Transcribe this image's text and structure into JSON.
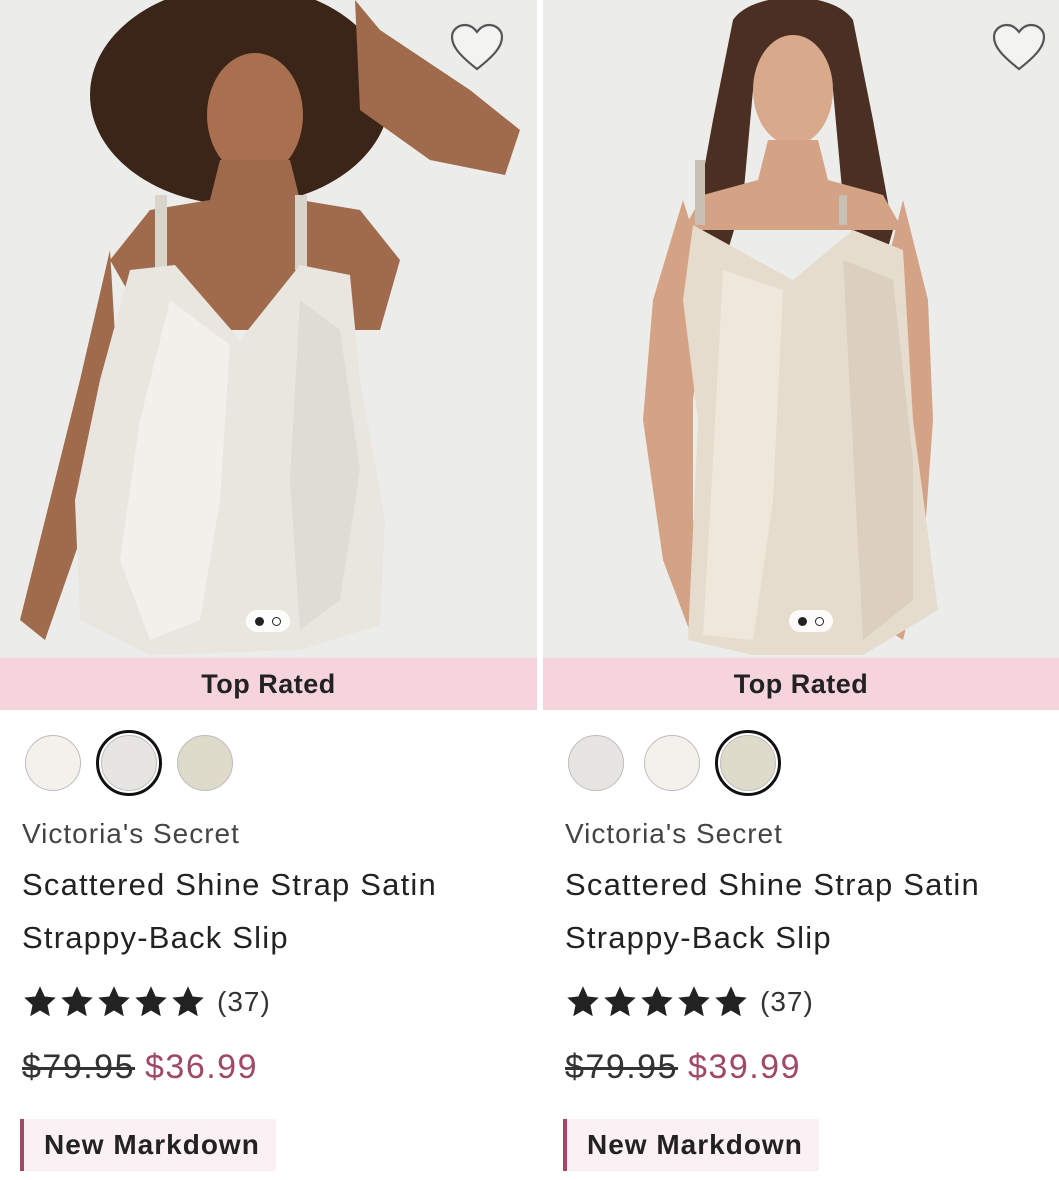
{
  "products": [
    {
      "badge": "Top Rated",
      "brand": "Victoria's Secret",
      "title": "Scattered Shine Strap Satin Strappy-Back Slip",
      "rating": 5,
      "review_count": "(37)",
      "original_price": "$79.95",
      "sale_price": "$36.99",
      "tag": "New Markdown",
      "image_count": 2,
      "active_image": 1,
      "swatches": [
        {
          "color": "#f4f1ec",
          "selected": false
        },
        {
          "color": "#e7e5e1",
          "selected": true
        },
        {
          "color": "#dedbcb",
          "selected": false
        }
      ]
    },
    {
      "badge": "Top Rated",
      "brand": "Victoria's Secret",
      "title": "Scattered Shine Strap Satin Strappy-Back Slip",
      "rating": 5,
      "review_count": "(37)",
      "original_price": "$79.95",
      "sale_price": "$39.99",
      "tag": "New Markdown",
      "image_count": 2,
      "active_image": 1,
      "swatches": [
        {
          "color": "#e7e5e1",
          "selected": false
        },
        {
          "color": "#f4f1ec",
          "selected": false
        },
        {
          "color": "#dedbcb",
          "selected": true
        }
      ]
    }
  ],
  "colors": {
    "badge_background": "#f5d4de",
    "sale_price": "#a04867",
    "markdown_accent": "#a04867",
    "image_background": "#ecedea"
  },
  "icons": {
    "favorite": "heart-icon",
    "rating": "star-icon"
  }
}
